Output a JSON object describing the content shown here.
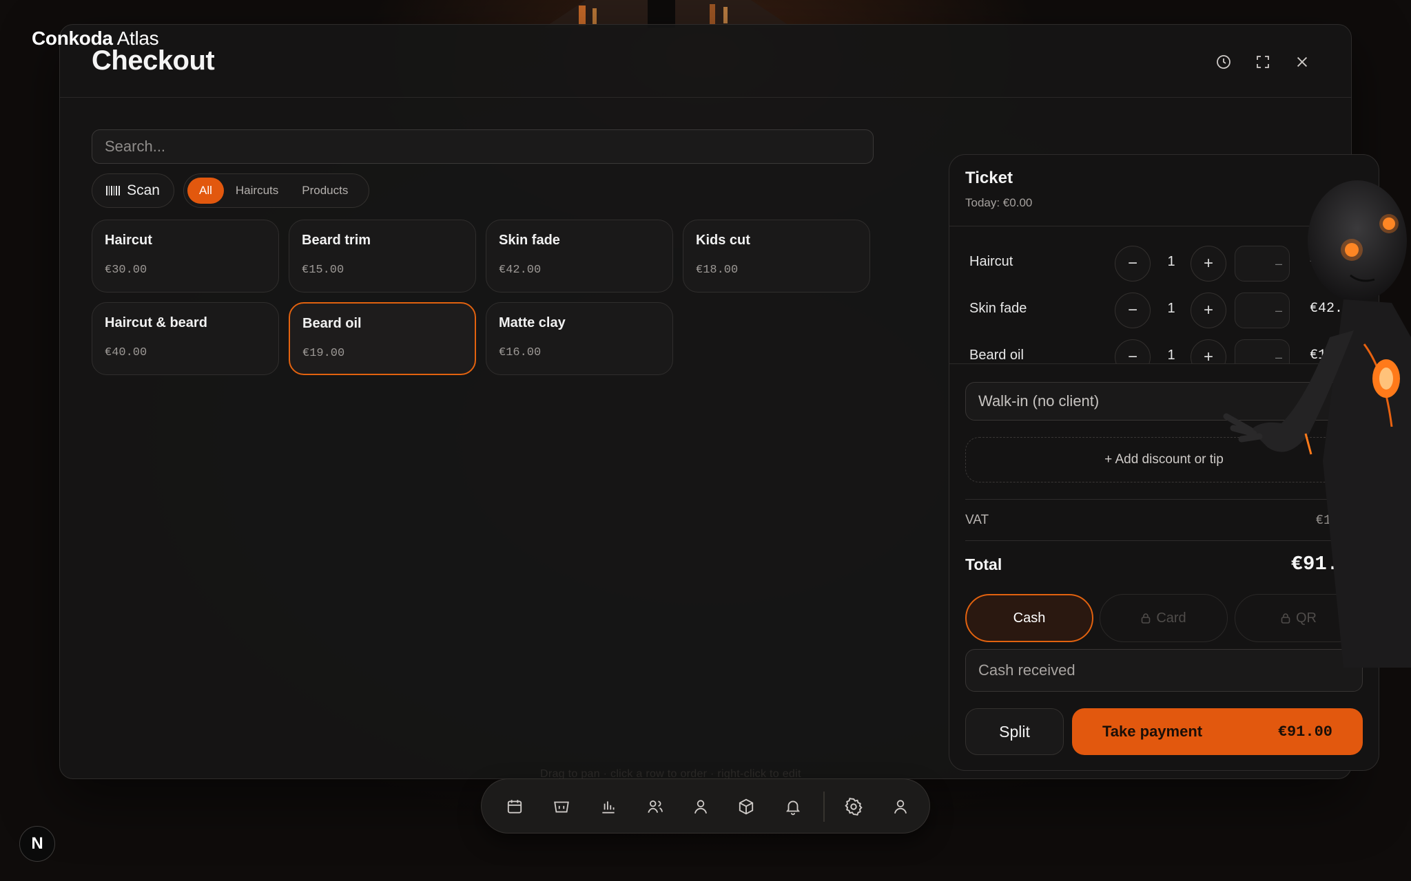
{
  "brand": {
    "bold": "Conkoda",
    "light": "Atlas"
  },
  "modal": {
    "title": "Checkout"
  },
  "header_icons": [
    "history-icon",
    "fullscreen-icon",
    "close-icon"
  ],
  "search": {
    "placeholder": "Search..."
  },
  "scan": {
    "label": "Scan"
  },
  "filters": [
    {
      "label": "All",
      "active": true
    },
    {
      "label": "Haircuts",
      "active": false
    },
    {
      "label": "Products",
      "active": false
    }
  ],
  "products": [
    {
      "name": "Haircut",
      "price": "€30.00",
      "selected": false
    },
    {
      "name": "Beard trim",
      "price": "€15.00",
      "selected": false
    },
    {
      "name": "Skin fade",
      "price": "€42.00",
      "selected": false
    },
    {
      "name": "Kids cut",
      "price": "€18.00",
      "selected": false
    },
    {
      "name": "Haircut & beard",
      "price": "€40.00",
      "selected": false
    },
    {
      "name": "Beard oil",
      "price": "€19.00",
      "selected": true
    },
    {
      "name": "Matte clay",
      "price": "€16.00",
      "selected": false
    }
  ],
  "ticket": {
    "title": "Ticket",
    "subtitle": "Today: €0.00",
    "lines": [
      {
        "name": "Haircut",
        "qty": "1",
        "discount": "–",
        "price": "€30.00"
      },
      {
        "name": "Skin fade",
        "qty": "1",
        "discount": "–",
        "price": "€42.00"
      },
      {
        "name": "Beard oil",
        "qty": "1",
        "discount": "–",
        "price": "€19.00"
      }
    ],
    "minus": "−",
    "plus": "+",
    "client": "Walk-in (no client)",
    "client_caret": "▾",
    "add_discount": "+ Add discount or tip",
    "vat_label": "VAT",
    "vat_value": "€15.80",
    "total_label": "Total",
    "total_value": "€91.00",
    "payment_methods": [
      {
        "label": "Cash",
        "active": true,
        "locked": false
      },
      {
        "label": "Card",
        "active": false,
        "locked": true
      },
      {
        "label": "QR",
        "active": false,
        "locked": true
      }
    ],
    "cash_placeholder": "Cash received",
    "split_label": "Split",
    "take_label": "Take payment",
    "take_amount": "€91.00"
  },
  "hint": "Drag to pan · click a row to order · right-click to edit",
  "dock": [
    "calendar-icon",
    "register-icon",
    "reports-icon",
    "clients-icon",
    "staff-icon",
    "inventory-icon",
    "notifications-icon",
    "settings-icon",
    "account-icon"
  ],
  "n_badge": "N",
  "colors": {
    "accent": "#e2580e",
    "background": "#161210",
    "panel": "#141313"
  }
}
